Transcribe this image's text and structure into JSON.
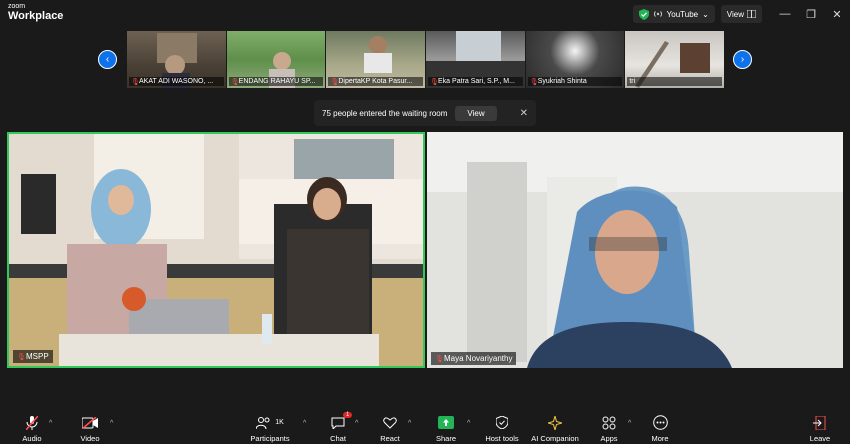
{
  "app": {
    "logo_small": "zoom",
    "logo_big": "Workplace"
  },
  "titlebar": {
    "youtube_label": "YouTube",
    "view_label": "View"
  },
  "thumbnails": [
    {
      "name": "AKAT ADI WASONO, ..."
    },
    {
      "name": "ENDANG RAHAYU SP..."
    },
    {
      "name": "DipertaKP Kota Pasur..."
    },
    {
      "name": "Eka Patra Sari, S.P., M..."
    },
    {
      "name": "Syukriah Shinta"
    },
    {
      "name": "tri"
    }
  ],
  "notice": {
    "text": "75 people entered the waiting room",
    "view_label": "View",
    "close_glyph": "✕"
  },
  "main_tiles": [
    {
      "name": "MSPP"
    },
    {
      "name": "Maya Novariyanthy"
    }
  ],
  "toolbar": {
    "audio": "Audio",
    "video": "Video",
    "participants": "Participants",
    "participants_count": "1K",
    "chat": "Chat",
    "chat_badge": "1",
    "react": "React",
    "share": "Share",
    "host_tools": "Host tools",
    "ai_companion": "AI Companion",
    "apps": "Apps",
    "more": "More",
    "leave": "Leave"
  },
  "colors": {
    "active_speaker": "#32c85c",
    "nav_arrow": "#0e72ed",
    "share_green": "#22b455",
    "muted_red": "#ff4d4d"
  }
}
